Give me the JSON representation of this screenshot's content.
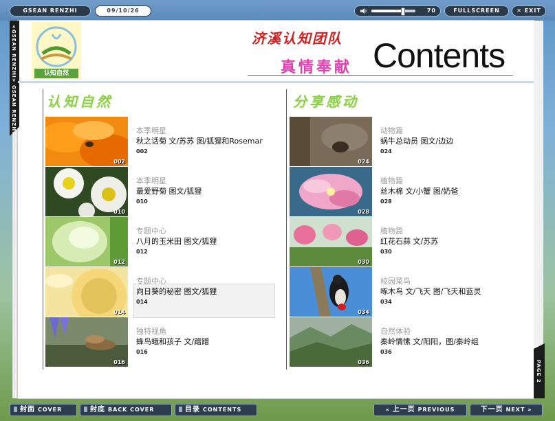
{
  "topbar": {
    "app_title": "GSEAN RENZHI",
    "issue_date": "09/10/26",
    "volume": 70,
    "volume_label": "70",
    "fullscreen_label": "FULLSCREEN",
    "exit_label": "EXIT"
  },
  "side_tab": {
    "label": "<GSEAN RENZHI> GSEAN RENZHI"
  },
  "header": {
    "logo_text": "认知自然",
    "team": "济溪认知团队",
    "motto": "真情奉献",
    "title": "Contents"
  },
  "left_column": {
    "title": "认知自然",
    "entries": [
      {
        "category": "本季明星",
        "title": "秋之话菊 文/苏苏 图/狐狸和Rosemar",
        "page": "002",
        "thumb_num": "002",
        "thumb": "orange-flower-ladybug"
      },
      {
        "category": "本季明星",
        "title": "最爱野菊 图文/狐狸",
        "page": "010",
        "thumb_num": "010",
        "thumb": "white-daisies"
      },
      {
        "category": "专题中心",
        "title": "八月的玉米田 图文/狐狸",
        "page": "012",
        "thumb_num": "012",
        "thumb": "corn-silk"
      },
      {
        "category": "专题中心",
        "title": "向日葵的秘密  图文/狐狸",
        "page": "014",
        "thumb_num": "014",
        "thumb": "sunflower"
      },
      {
        "category": "独特视角",
        "title": "蜂鸟蛾和孩子 文/蹭蹭",
        "page": "016",
        "thumb_num": "016",
        "thumb": "hawk-moth"
      }
    ]
  },
  "right_column": {
    "title": "分享感动",
    "entries": [
      {
        "category": "动物篇",
        "title": "蜗牛总动员 图文/边边",
        "page": "024",
        "thumb_num": "024",
        "thumb": "snail"
      },
      {
        "category": "植物篇",
        "title": "丝木棉 文/小蟹 图/奶爸",
        "page": "028",
        "thumb_num": "028",
        "thumb": "pink-silk-flower"
      },
      {
        "category": "植物篇",
        "title": "红花石蒜 文/苏苏",
        "page": "030",
        "thumb_num": "030",
        "thumb": "red-spider-lily"
      },
      {
        "category": "校园菜鸟",
        "title": "啄木鸟 文/飞天 图/飞天和蓝灵",
        "page": "034",
        "thumb_num": "034",
        "thumb": "woodpecker"
      },
      {
        "category": "自然体验",
        "title": "秦岭情愫 文/阳阳，图/秦岭组",
        "page": "036",
        "thumb_num": "036",
        "thumb": "mountains"
      }
    ]
  },
  "page_tab": {
    "label": "PAGE 2"
  },
  "bottombar": {
    "cover_zh": "封面",
    "cover_en": "COVER",
    "back_zh": "封底",
    "back_en": "BACK COVER",
    "toc_zh": "目录",
    "toc_en": "CONTENTS",
    "prev_zh": "上一页",
    "prev_en": "PREVIOUS",
    "next_zh": "下一页",
    "next_en": "NEXT"
  },
  "colors": {
    "accent_green": "#8fd04a",
    "team_red": "#d42020",
    "motto_pink": "#e040b0",
    "bar_dark": "#2c3d4f"
  }
}
